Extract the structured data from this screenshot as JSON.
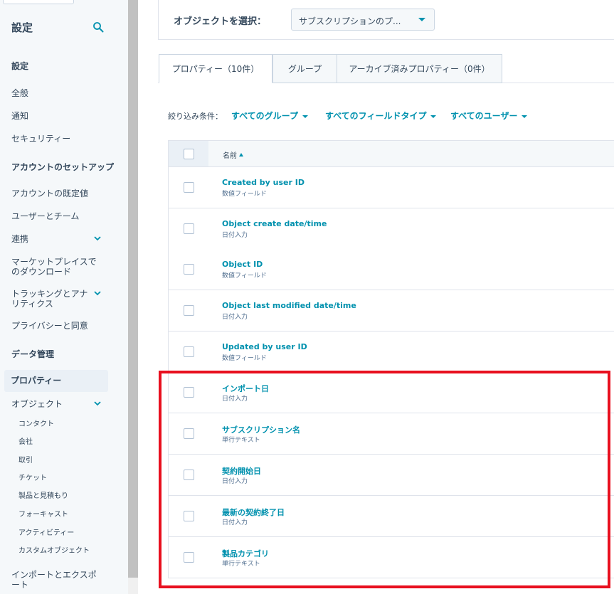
{
  "sidebar": {
    "title": "設定",
    "items": [
      {
        "label": "設定",
        "kind": "section"
      },
      {
        "label": "全般",
        "kind": "item"
      },
      {
        "label": "通知",
        "kind": "item"
      },
      {
        "label": "セキュリティー",
        "kind": "item"
      },
      {
        "label": "アカウントのセットアップ",
        "kind": "section"
      },
      {
        "label": "アカウントの既定値",
        "kind": "item"
      },
      {
        "label": "ユーザーとチーム",
        "kind": "item"
      },
      {
        "label": "連携",
        "kind": "item",
        "expandable": true
      },
      {
        "label": "マーケットプレイスでのダウンロード",
        "kind": "item"
      },
      {
        "label": "トラッキングとアナリティクス",
        "kind": "item",
        "expandable": true
      },
      {
        "label": "プライバシーと同意",
        "kind": "item"
      },
      {
        "label": "データ管理",
        "kind": "section"
      },
      {
        "label": "プロパティー",
        "kind": "active"
      },
      {
        "label": "オブジェクト",
        "kind": "item",
        "expandable": true
      },
      {
        "label": "コンタクト",
        "kind": "sub"
      },
      {
        "label": "会社",
        "kind": "sub"
      },
      {
        "label": "取引",
        "kind": "sub"
      },
      {
        "label": "チケット",
        "kind": "sub"
      },
      {
        "label": "製品と見積もり",
        "kind": "sub"
      },
      {
        "label": "フォーキャスト",
        "kind": "sub"
      },
      {
        "label": "アクティビティー",
        "kind": "sub"
      },
      {
        "label": "カスタムオブジェクト",
        "kind": "sub"
      },
      {
        "label": "インポートとエクスポート",
        "kind": "item"
      }
    ]
  },
  "selector": {
    "label": "オブジェクトを選択：",
    "value": "サブスクリプションのプ..."
  },
  "tabs": [
    {
      "label": "プロパティー（10件）",
      "active": true
    },
    {
      "label": "グループ",
      "active": false
    },
    {
      "label": "アーカイブ済みプロパティー（0件）",
      "active": false
    }
  ],
  "filters": {
    "label": "絞り込み条件：",
    "group": "すべてのグループ",
    "field_type": "すべてのフィールドタイプ",
    "user": "すべてのユーザー"
  },
  "table": {
    "header_name": "名前",
    "rows": [
      {
        "name": "Created by user ID",
        "type": "数値フィールド"
      },
      {
        "name": "Object create date/time",
        "type": "日付入力"
      },
      {
        "name": "Object ID",
        "type": "数値フィールド"
      },
      {
        "name": "Object last modified date/time",
        "type": "日付入力"
      },
      {
        "name": "Updated by user ID",
        "type": "数値フィールド"
      },
      {
        "name": "インポート日",
        "type": "日付入力"
      },
      {
        "name": "サブスクリプション名",
        "type": "単行テキスト"
      },
      {
        "name": "契約開始日",
        "type": "日付入力"
      },
      {
        "name": "最新の契約終了日",
        "type": "日付入力"
      },
      {
        "name": "製品カテゴリ",
        "type": "単行テキスト"
      }
    ]
  },
  "colors": {
    "accent": "#0091ae",
    "highlight": "#e8101f"
  }
}
